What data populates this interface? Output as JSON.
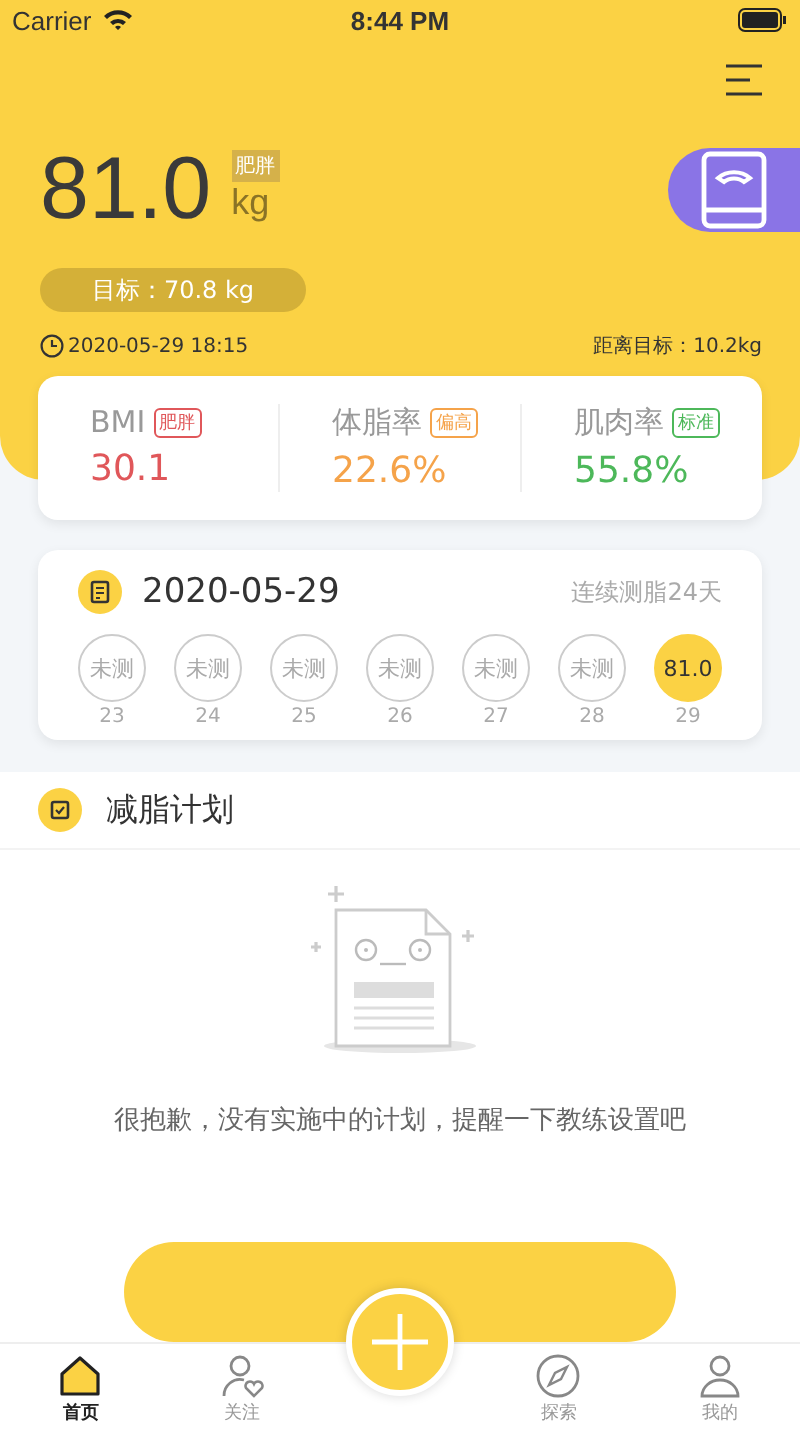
{
  "status_bar": {
    "carrier": "Carrier",
    "time": "8:44 PM"
  },
  "weight": {
    "value": "81.0",
    "tag": "肥胖",
    "unit": "kg",
    "target": "目标：70.8 kg",
    "measured_at": "2020-05-29 18:15",
    "to_target": "距离目标：10.2kg"
  },
  "metrics": [
    {
      "label": "BMI",
      "tag": "肥胖",
      "value": "30.1",
      "color": "#e0575a"
    },
    {
      "label": "体脂率",
      "tag": "偏高",
      "value": "22.6%",
      "color": "#f5a34a"
    },
    {
      "label": "肌肉率",
      "tag": "标准",
      "value": "55.8%",
      "color": "#4db85a"
    }
  ],
  "record": {
    "date": "2020-05-29",
    "streak": "连续测脂24天",
    "days": [
      {
        "value": "未测",
        "day": "23",
        "selected": false
      },
      {
        "value": "未测",
        "day": "24",
        "selected": false
      },
      {
        "value": "未测",
        "day": "25",
        "selected": false
      },
      {
        "value": "未测",
        "day": "26",
        "selected": false
      },
      {
        "value": "未测",
        "day": "27",
        "selected": false
      },
      {
        "value": "未测",
        "day": "28",
        "selected": false
      },
      {
        "value": "81.0",
        "day": "29",
        "selected": true
      }
    ]
  },
  "plan": {
    "title": "减脂计划",
    "empty_message": "很抱歉，没有实施中的计划，提醒一下教练设置吧"
  },
  "tabs": [
    {
      "label": "首页",
      "kind": "home",
      "selected": true
    },
    {
      "label": "关注",
      "kind": "follow",
      "selected": false
    },
    {
      "kind": "add"
    },
    {
      "label": "探索",
      "kind": "explore",
      "selected": false
    },
    {
      "label": "我的",
      "kind": "me",
      "selected": false
    }
  ]
}
